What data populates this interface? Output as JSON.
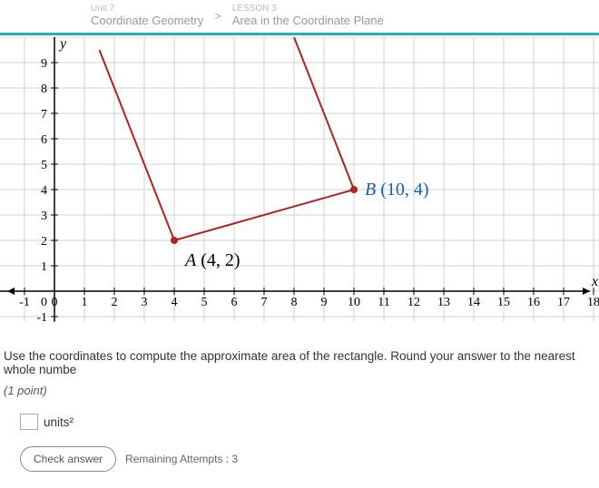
{
  "breadcrumb": {
    "unit_small": "Unit 7",
    "unit_label": "Coordinate Geometry",
    "sep": ">",
    "lesson_small": "LESSON 3",
    "lesson_label": "Area in the Coordinate Plane"
  },
  "question": {
    "text": "Use the coordinates to compute the approximate area of the rectangle. Round your answer to the nearest whole numbe",
    "points": "(1 point)",
    "units_label": "units²"
  },
  "buttons": {
    "check": "Check answer",
    "remaining": "Remaining Attempts : 3"
  },
  "chart_data": {
    "type": "scatter",
    "title": "",
    "xlabel": "x",
    "ylabel": "y",
    "xlim": [
      -1,
      18
    ],
    "ylim": [
      -1,
      9
    ],
    "x_ticks": [
      -1,
      0,
      1,
      2,
      3,
      4,
      5,
      6,
      7,
      8,
      9,
      10,
      11,
      12,
      13,
      14,
      15,
      16,
      17,
      18
    ],
    "y_ticks": [
      -1,
      0,
      1,
      2,
      3,
      4,
      5,
      6,
      7,
      8,
      9
    ],
    "grid": true,
    "points": [
      {
        "name": "A",
        "x": 4,
        "y": 2,
        "label": "A (4, 2)"
      },
      {
        "name": "B",
        "x": 10,
        "y": 4,
        "label": "B (10, 4)"
      }
    ],
    "segments": [
      {
        "from": {
          "x": 4,
          "y": 2
        },
        "to": {
          "x": 10,
          "y": 4
        }
      },
      {
        "from": {
          "x": 4,
          "y": 2
        },
        "to": {
          "x": 1.5,
          "y": 9.5
        }
      },
      {
        "from": {
          "x": 10,
          "y": 4
        },
        "to": {
          "x": 7.5,
          "y": 11.5
        }
      }
    ]
  }
}
